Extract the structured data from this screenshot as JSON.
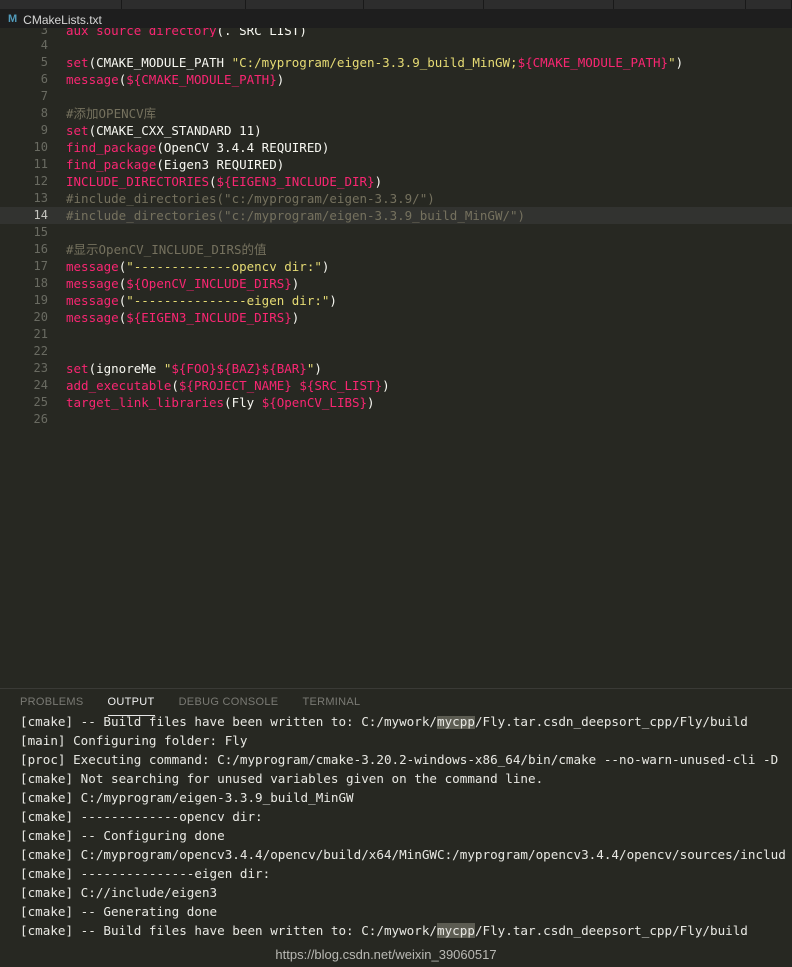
{
  "window": {
    "tabstrip_slot_widths": [
      122,
      124,
      118,
      120,
      130,
      132,
      46
    ]
  },
  "editor_tab": {
    "icon": "cmake-file-icon",
    "icon_glyph": "M",
    "title": "CMakeLists.txt"
  },
  "editor": {
    "active_line": 14,
    "lines": [
      {
        "n": 3,
        "clipped": true,
        "tokens": [
          {
            "c": "t-fn",
            "t": "aux_source_directory"
          },
          {
            "c": "t-punct",
            "t": "("
          },
          {
            "c": "t-plain",
            "t": ". SRC_LIST"
          },
          {
            "c": "t-punct",
            "t": ")"
          }
        ]
      },
      {
        "n": 4,
        "tokens": []
      },
      {
        "n": 5,
        "tokens": [
          {
            "c": "t-fn",
            "t": "set"
          },
          {
            "c": "t-punct",
            "t": "("
          },
          {
            "c": "t-plain",
            "t": "CMAKE_MODULE_PATH "
          },
          {
            "c": "t-str",
            "t": "\"C:/myprogram/eigen-3.3.9_build_MinGW;"
          },
          {
            "c": "t-var",
            "t": "${CMAKE_MODULE_PATH}"
          },
          {
            "c": "t-str",
            "t": "\""
          },
          {
            "c": "t-punct",
            "t": ")"
          }
        ]
      },
      {
        "n": 6,
        "tokens": [
          {
            "c": "t-fn",
            "t": "message"
          },
          {
            "c": "t-punct",
            "t": "("
          },
          {
            "c": "t-var",
            "t": "${CMAKE_MODULE_PATH}"
          },
          {
            "c": "t-punct",
            "t": ")"
          }
        ]
      },
      {
        "n": 7,
        "tokens": []
      },
      {
        "n": 8,
        "tokens": [
          {
            "c": "t-com",
            "t": "#添加OPENCV库"
          }
        ]
      },
      {
        "n": 9,
        "tokens": [
          {
            "c": "t-fn",
            "t": "set"
          },
          {
            "c": "t-punct",
            "t": "("
          },
          {
            "c": "t-plain",
            "t": "CMAKE_CXX_STANDARD 11"
          },
          {
            "c": "t-punct",
            "t": ")"
          }
        ]
      },
      {
        "n": 10,
        "tokens": [
          {
            "c": "t-fn",
            "t": "find_package"
          },
          {
            "c": "t-punct",
            "t": "("
          },
          {
            "c": "t-plain",
            "t": "OpenCV 3.4.4 REQUIRED"
          },
          {
            "c": "t-punct",
            "t": ")"
          }
        ]
      },
      {
        "n": 11,
        "tokens": [
          {
            "c": "t-fn",
            "t": "find_package"
          },
          {
            "c": "t-punct",
            "t": "("
          },
          {
            "c": "t-plain",
            "t": "Eigen3 REQUIRED"
          },
          {
            "c": "t-punct",
            "t": ")"
          }
        ]
      },
      {
        "n": 12,
        "tokens": [
          {
            "c": "t-fn",
            "t": "INCLUDE_DIRECTORIES"
          },
          {
            "c": "t-punct",
            "t": "("
          },
          {
            "c": "t-var",
            "t": "${EIGEN3_INCLUDE_DIR}"
          },
          {
            "c": "t-punct",
            "t": ")"
          }
        ]
      },
      {
        "n": 13,
        "tokens": [
          {
            "c": "t-com",
            "t": "#include_directories(\"c:/myprogram/eigen-3.3.9/\")"
          }
        ]
      },
      {
        "n": 14,
        "tokens": [
          {
            "c": "t-com",
            "t": "#include_directories(\"c:/myprogram/eigen-3.3.9_build_MinGW/\")"
          }
        ]
      },
      {
        "n": 15,
        "tokens": []
      },
      {
        "n": 16,
        "tokens": [
          {
            "c": "t-com",
            "t": "#显示OpenCV_INCLUDE_DIRS的值"
          }
        ]
      },
      {
        "n": 17,
        "tokens": [
          {
            "c": "t-fn",
            "t": "message"
          },
          {
            "c": "t-punct",
            "t": "("
          },
          {
            "c": "t-str",
            "t": "\"-------------opencv dir:\""
          },
          {
            "c": "t-punct",
            "t": ")"
          }
        ]
      },
      {
        "n": 18,
        "tokens": [
          {
            "c": "t-fn",
            "t": "message"
          },
          {
            "c": "t-punct",
            "t": "("
          },
          {
            "c": "t-var",
            "t": "${OpenCV_INCLUDE_DIRS}"
          },
          {
            "c": "t-punct",
            "t": ")"
          }
        ]
      },
      {
        "n": 19,
        "tokens": [
          {
            "c": "t-fn",
            "t": "message"
          },
          {
            "c": "t-punct",
            "t": "("
          },
          {
            "c": "t-str",
            "t": "\"---------------eigen dir:\""
          },
          {
            "c": "t-punct",
            "t": ")"
          }
        ]
      },
      {
        "n": 20,
        "tokens": [
          {
            "c": "t-fn",
            "t": "message"
          },
          {
            "c": "t-punct",
            "t": "("
          },
          {
            "c": "t-var",
            "t": "${EIGEN3_INCLUDE_DIRS}"
          },
          {
            "c": "t-punct",
            "t": ")"
          }
        ]
      },
      {
        "n": 21,
        "tokens": []
      },
      {
        "n": 22,
        "tokens": []
      },
      {
        "n": 23,
        "tokens": [
          {
            "c": "t-fn",
            "t": "set"
          },
          {
            "c": "t-punct",
            "t": "("
          },
          {
            "c": "t-plain",
            "t": "ignoreMe "
          },
          {
            "c": "t-str",
            "t": "\""
          },
          {
            "c": "t-var",
            "t": "${FOO}${BAZ}${BAR}"
          },
          {
            "c": "t-str",
            "t": "\""
          },
          {
            "c": "t-punct",
            "t": ")"
          }
        ]
      },
      {
        "n": 24,
        "tokens": [
          {
            "c": "t-fn",
            "t": "add_executable"
          },
          {
            "c": "t-punct",
            "t": "("
          },
          {
            "c": "t-var",
            "t": "${PROJECT_NAME}"
          },
          {
            "c": "t-plain",
            "t": " "
          },
          {
            "c": "t-var",
            "t": "${SRC_LIST}"
          },
          {
            "c": "t-punct",
            "t": ")"
          }
        ]
      },
      {
        "n": 25,
        "tokens": [
          {
            "c": "t-fn",
            "t": "target_link_libraries"
          },
          {
            "c": "t-punct",
            "t": "("
          },
          {
            "c": "t-plain",
            "t": "Fly "
          },
          {
            "c": "t-var",
            "t": "${OpenCV_LIBS}"
          },
          {
            "c": "t-punct",
            "t": ")"
          }
        ]
      },
      {
        "n": 26,
        "tokens": []
      }
    ]
  },
  "panel": {
    "tabs": [
      {
        "label": "PROBLEMS",
        "active": false
      },
      {
        "label": "OUTPUT",
        "active": true
      },
      {
        "label": "DEBUG CONSOLE",
        "active": false
      },
      {
        "label": "TERMINAL",
        "active": false
      }
    ],
    "output_lines": [
      {
        "clipped": true,
        "parts": [
          {
            "t": "[cmake] -- Build files have been written to: C:/mywork/"
          },
          {
            "t": "mycpp",
            "hl": true
          },
          {
            "t": "/Fly.tar.csdn_deepsort_cpp/Fly/build"
          }
        ]
      },
      {
        "parts": [
          {
            "t": "[main] Configuring folder: Fly"
          }
        ]
      },
      {
        "parts": [
          {
            "t": "[proc] Executing command: C:/myprogram/cmake-3.20.2-windows-x86_64/bin/cmake --no-warn-unused-cli -D"
          }
        ]
      },
      {
        "parts": [
          {
            "t": "[cmake] Not searching for unused variables given on the command line."
          }
        ]
      },
      {
        "parts": [
          {
            "t": "[cmake] C:/myprogram/eigen-3.3.9_build_MinGW"
          }
        ]
      },
      {
        "parts": [
          {
            "t": "[cmake] -------------opencv dir:"
          }
        ]
      },
      {
        "parts": [
          {
            "t": "[cmake] -- Configuring done"
          }
        ]
      },
      {
        "parts": [
          {
            "t": "[cmake] C:/myprogram/opencv3.4.4/opencv/build/x64/MinGWC:/myprogram/opencv3.4.4/opencv/sources/includ"
          }
        ]
      },
      {
        "parts": [
          {
            "t": "[cmake] ---------------eigen dir:"
          }
        ]
      },
      {
        "parts": [
          {
            "t": "[cmake] C://include/eigen3"
          }
        ]
      },
      {
        "parts": [
          {
            "t": "[cmake] -- Generating done"
          }
        ]
      },
      {
        "parts": [
          {
            "t": "[cmake] -- Build files have been written to: C:/mywork/"
          },
          {
            "t": "mycpp",
            "hl": true
          },
          {
            "t": "/Fly.tar.csdn_deepsort_cpp/Fly/build"
          }
        ]
      }
    ],
    "watermark": "https://blog.csdn.net/weixin_39060517"
  },
  "colors": {
    "editor_bg": "#272822",
    "panel_bg": "#272822",
    "tab_bg": "#1e1e1e",
    "active_line_bg": "#323330",
    "keyword": "#f92672",
    "string": "#e6db74",
    "comment": "#75715e",
    "plain": "#f8f8f2",
    "search_highlight": "#5c5c52"
  }
}
